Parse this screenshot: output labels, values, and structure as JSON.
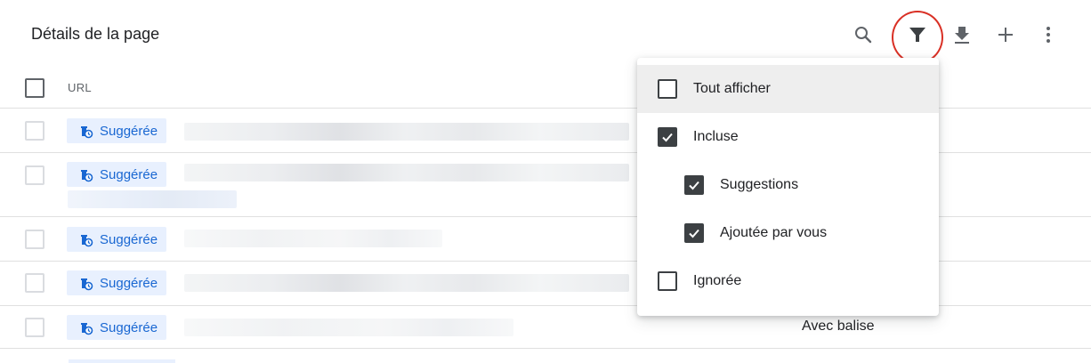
{
  "header": {
    "title": "Détails de la page",
    "icons": [
      "search-icon",
      "filter-icon",
      "download-icon",
      "add-icon",
      "more-vert-icon"
    ]
  },
  "table": {
    "url_header": "URL",
    "rows": [
      {
        "status": "Suggérée",
        "right_text": ""
      },
      {
        "status": "Suggérée",
        "right_text": ""
      },
      {
        "status": "Suggérée",
        "right_text": ""
      },
      {
        "status": "Suggérée",
        "right_text": ""
      },
      {
        "status": "Suggérée",
        "right_text": "Avec balise"
      }
    ]
  },
  "filter_menu": {
    "items": [
      {
        "label": "Tout afficher",
        "checked": false
      },
      {
        "label": "Incluse",
        "checked": true
      },
      {
        "label": "Suggestions",
        "checked": true
      },
      {
        "label": "Ajoutée par vous",
        "checked": true
      },
      {
        "label": "Ignorée",
        "checked": false
      }
    ]
  },
  "colors": {
    "chip_bg": "#e8f0fe",
    "chip_text": "#1967d2",
    "highlight": "#d93025"
  }
}
